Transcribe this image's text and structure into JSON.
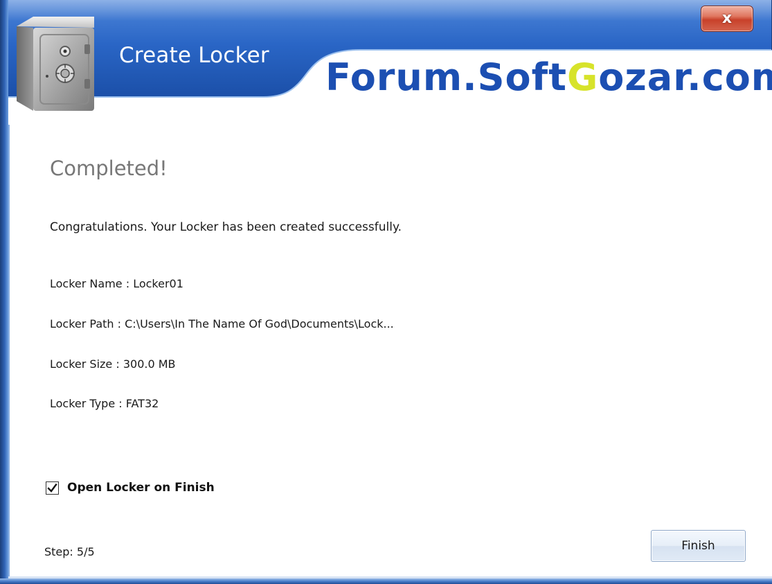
{
  "window": {
    "title": "Create Locker",
    "close_label": "x",
    "watermark_prefix": "Forum.Soft",
    "watermark_highlight": "G",
    "watermark_suffix": "ozar.com"
  },
  "content": {
    "heading": "Completed!",
    "message": "Congratulations. Your Locker has been created successfully.",
    "locker_name": "Locker Name : Locker01",
    "locker_path": "Locker Path : C:\\Users\\In The Name Of God\\Documents\\Lock...",
    "locker_size": "Locker Size : 300.0 MB",
    "locker_type": "Locker Type : FAT32"
  },
  "options": {
    "open_on_finish_label": "Open Locker on Finish",
    "open_on_finish_checked": true
  },
  "footer": {
    "step": "Step: 5/5",
    "finish_label": "Finish"
  },
  "colors": {
    "header_blue": "#1e5fc4",
    "frame_blue": "#2f63b5",
    "watermark_blue": "#1c4fb2",
    "watermark_highlight": "#d7e32a",
    "close_red": "#c8412a"
  }
}
